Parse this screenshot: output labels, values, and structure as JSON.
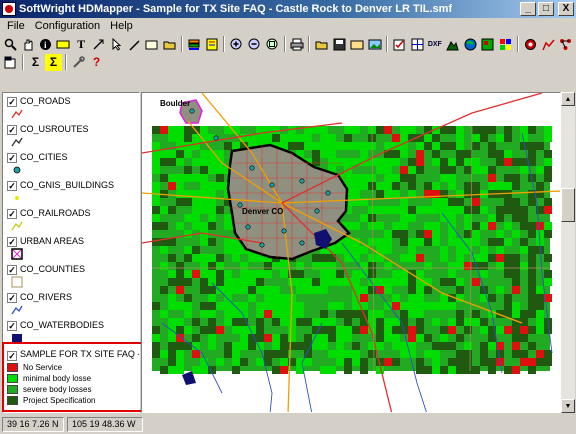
{
  "window": {
    "title": "SoftWright HDMapper - Sample for TX Site FAQ - Castle Rock to Denver LR TIL.smf",
    "minimize": "_",
    "maximize": "□",
    "close": "X"
  },
  "menu": [
    "File",
    "Configuration",
    "Help"
  ],
  "legend": {
    "layers": [
      {
        "name": "CO_ROADS",
        "checked": true,
        "icon": "road-line-icon",
        "color": "#e03030"
      },
      {
        "name": "CO_USROUTES",
        "checked": true,
        "icon": "route-line-icon",
        "color": "#333333"
      },
      {
        "name": "CO_CITIES",
        "checked": true,
        "icon": "city-dot-icon",
        "color": "#20a0a0"
      },
      {
        "name": "CO_GNIS_BUILDINGS",
        "checked": true,
        "icon": "building-dot-icon",
        "color": "#e8e800"
      },
      {
        "name": "CO_RAILROADS",
        "checked": true,
        "icon": "railroad-line-icon",
        "color": "#c8c820"
      },
      {
        "name": "URBAN AREAS",
        "checked": true,
        "icon": "urban-area-icon",
        "color": "#e020e0"
      },
      {
        "name": "CO_COUNTIES",
        "checked": true,
        "icon": "county-polygon-icon",
        "color": "#d8c8a8"
      },
      {
        "name": "CO_RIVERS",
        "checked": true,
        "icon": "river-line-icon",
        "color": "#3050c0"
      },
      {
        "name": "CO_WATERBODIES",
        "checked": true,
        "icon": "waterbody-polygon-icon",
        "color": "#101070"
      }
    ],
    "sample_layer": {
      "name": "SAMPLE FOR TX SITE FAQ - CAS",
      "checked": true,
      "items": [
        {
          "label": "No Service",
          "color": "#e01010"
        },
        {
          "label": "minimal body losse",
          "color": "#00dd00"
        },
        {
          "label": "severe body losses",
          "color": "#22aa22"
        },
        {
          "label": "Project Specification",
          "color": "#205a10"
        }
      ]
    }
  },
  "map": {
    "labels": {
      "north_city": "Boulder",
      "main_city": "Denver CO"
    },
    "colors": {
      "no_service": "#e01010",
      "minimal": "#00dd00",
      "severe": "#22aa22",
      "project": "#205a10",
      "roads": "#e03030",
      "highways": "#f0a000",
      "rivers": "#3050c0",
      "urban_fill": "#909080"
    }
  },
  "status": {
    "latitude": "39 16 7.26 N",
    "longitude": "105 19 48.36 W"
  }
}
